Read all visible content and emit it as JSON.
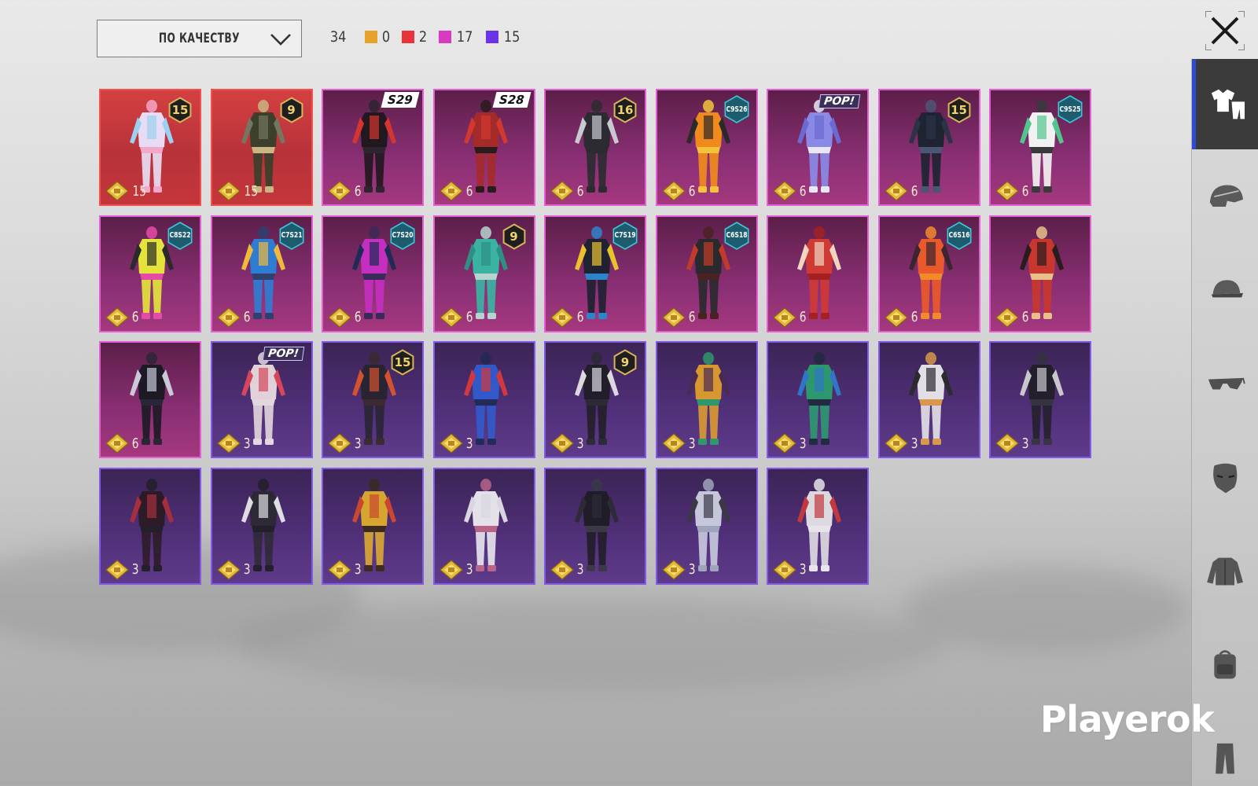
{
  "sort": {
    "label": "ПО КАЧЕСТВУ"
  },
  "counts": {
    "total": "34",
    "qualities": [
      {
        "name": "gold",
        "color": "#e8a22c",
        "count": "0"
      },
      {
        "name": "red",
        "color": "#e8333a",
        "count": "2"
      },
      {
        "name": "pink",
        "color": "#d93ac2",
        "count": "17"
      },
      {
        "name": "purple",
        "color": "#6a33e6",
        "count": "15"
      }
    ]
  },
  "watermark": "Playerok",
  "items": [
    {
      "q": "red",
      "badge": "hex",
      "badge_text": "15",
      "price": "15",
      "palette": [
        "#e8dcf5",
        "#9ad0f0",
        "#f3a7c9"
      ]
    },
    {
      "q": "red",
      "badge": "hex",
      "badge_text": "9",
      "price": "15",
      "palette": [
        "#3b3f2c",
        "#74765f",
        "#c9b683"
      ]
    },
    {
      "q": "pink",
      "badge": "season",
      "badge_text": "S29",
      "price": "6",
      "palette": [
        "#221820",
        "#d5352f",
        "#2d2430"
      ]
    },
    {
      "q": "pink",
      "badge": "season",
      "badge_text": "S28",
      "price": "6",
      "palette": [
        "#a52a2a",
        "#d2382e",
        "#2a1b1e"
      ]
    },
    {
      "q": "pink",
      "badge": "hex",
      "badge_text": "16",
      "price": "6",
      "palette": [
        "#2b2b31",
        "#c9c9d1",
        "#2d2b2f"
      ]
    },
    {
      "q": "pink",
      "badge": "cs",
      "badge_text": "C9S26",
      "price": "6",
      "palette": [
        "#f08a1c",
        "#2a2a2a",
        "#f4c33a"
      ]
    },
    {
      "q": "pink",
      "badge": "pop",
      "badge_text": "POP!",
      "price": "6",
      "palette": [
        "#8a8ae6",
        "#6a6ad1",
        "#e8e8f5"
      ]
    },
    {
      "q": "pink",
      "badge": "hex",
      "badge_text": "15",
      "price": "6",
      "palette": [
        "#1e2432",
        "#2c3346",
        "#4a5672"
      ]
    },
    {
      "q": "pink",
      "badge": "cs",
      "badge_text": "C9S25",
      "price": "6",
      "palette": [
        "#f1f1f1",
        "#52c58f",
        "#3a3a3a"
      ]
    },
    {
      "q": "pink",
      "badge": "cs",
      "badge_text": "C8S22",
      "price": "6",
      "palette": [
        "#e3e33b",
        "#2a2a2a",
        "#e64aa8"
      ]
    },
    {
      "q": "pink",
      "badge": "cs",
      "badge_text": "C7S21",
      "price": "6",
      "palette": [
        "#2f7dd3",
        "#f1b93a",
        "#2f3f6e"
      ]
    },
    {
      "q": "pink",
      "badge": "cs",
      "badge_text": "C7S20",
      "price": "6",
      "palette": [
        "#c42fbf",
        "#1f2a55",
        "#3a2a5a"
      ]
    },
    {
      "q": "pink",
      "badge": "hex",
      "badge_text": "9",
      "price": "6",
      "palette": [
        "#3ab3a3",
        "#2f8f85",
        "#b7d3ce"
      ]
    },
    {
      "q": "pink",
      "badge": "cs",
      "badge_text": "C7S19",
      "price": "6",
      "palette": [
        "#1f2233",
        "#e8c32e",
        "#2e84c9"
      ]
    },
    {
      "q": "pink",
      "badge": "cs",
      "badge_text": "C6S18",
      "price": "6",
      "palette": [
        "#2a2a2e",
        "#c23a2a",
        "#4a2222"
      ]
    },
    {
      "q": "pink",
      "badge": "",
      "badge_text": "",
      "price": "6",
      "palette": [
        "#cf3a35",
        "#f0d6c0",
        "#a52121"
      ]
    },
    {
      "q": "pink",
      "badge": "cs",
      "badge_text": "C6S16",
      "price": "6",
      "palette": [
        "#e85a2a",
        "#3a2530",
        "#f08a2a"
      ]
    },
    {
      "q": "pink",
      "badge": "",
      "badge_text": "",
      "price": "6",
      "palette": [
        "#c8372e",
        "#2a1c1c",
        "#e7c08a"
      ]
    },
    {
      "q": "pink",
      "badge": "",
      "badge_text": "",
      "price": "6",
      "palette": [
        "#1d1a25",
        "#c9c9d8",
        "#2a2638"
      ]
    },
    {
      "q": "purple",
      "badge": "pop",
      "badge_text": "POP!",
      "price": "3",
      "palette": [
        "#f1e4e4",
        "#e64a5a",
        "#f4eaea"
      ]
    },
    {
      "q": "purple",
      "badge": "hex",
      "badge_text": "15",
      "price": "3",
      "palette": [
        "#26242c",
        "#e2572a",
        "#3a2a2a"
      ]
    },
    {
      "q": "purple",
      "badge": "",
      "badge_text": "",
      "price": "3",
      "palette": [
        "#2f5ed3",
        "#e03a3a",
        "#1e2a55"
      ]
    },
    {
      "q": "purple",
      "badge": "hex",
      "badge_text": "9",
      "price": "3",
      "palette": [
        "#1d1d22",
        "#ececec",
        "#2a2a30"
      ]
    },
    {
      "q": "purple",
      "badge": "",
      "badge_text": "",
      "price": "3",
      "palette": [
        "#e6a32a",
        "#4a2a55",
        "#2ba36a"
      ]
    },
    {
      "q": "purple",
      "badge": "",
      "badge_text": "",
      "price": "3",
      "palette": [
        "#2aa36f",
        "#2f7dd3",
        "#1e2a3a"
      ]
    },
    {
      "q": "purple",
      "badge": "",
      "badge_text": "",
      "price": "3",
      "palette": [
        "#f2f2f2",
        "#2a2a2a",
        "#e8a34a"
      ]
    },
    {
      "q": "purple",
      "badge": "",
      "badge_text": "",
      "price": "3",
      "palette": [
        "#1f1f25",
        "#d8d8d8",
        "#34343c"
      ]
    },
    {
      "q": "purple",
      "badge": "",
      "badge_text": "",
      "price": "3",
      "palette": [
        "#2a1a1f",
        "#b0303a",
        "#1f1f24"
      ]
    },
    {
      "q": "purple",
      "badge": "",
      "badge_text": "",
      "price": "3",
      "palette": [
        "#2a2a30",
        "#f0f0f0",
        "#1f1f25"
      ]
    },
    {
      "q": "purple",
      "badge": "",
      "badge_text": "",
      "price": "3",
      "palette": [
        "#e5b32a",
        "#d94a2a",
        "#3a2a1a"
      ]
    },
    {
      "q": "purple",
      "badge": "",
      "badge_text": "",
      "price": "3",
      "palette": [
        "#f5f5f7",
        "#e9e9ef",
        "#c46a8a"
      ]
    },
    {
      "q": "purple",
      "badge": "",
      "badge_text": "",
      "price": "3",
      "palette": [
        "#1c1c22",
        "#2b2b33",
        "#3a3a44"
      ]
    },
    {
      "q": "purple",
      "badge": "",
      "badge_text": "",
      "price": "3",
      "palette": [
        "#d3d8e6",
        "#3a3a44",
        "#a8b0c4"
      ]
    },
    {
      "q": "purple",
      "badge": "",
      "badge_text": "",
      "price": "3",
      "palette": [
        "#ececec",
        "#d13a3a",
        "#f7f7f7"
      ]
    }
  ],
  "categories": [
    {
      "name": "outfit-icon",
      "active": true
    },
    {
      "name": "helmet-icon",
      "active": false
    },
    {
      "name": "cap-icon",
      "active": false
    },
    {
      "name": "glasses-icon",
      "active": false
    },
    {
      "name": "mask-icon",
      "active": false
    },
    {
      "name": "jacket-icon",
      "active": false
    },
    {
      "name": "backpack-icon",
      "active": false
    },
    {
      "name": "pants-icon",
      "active": false
    }
  ]
}
